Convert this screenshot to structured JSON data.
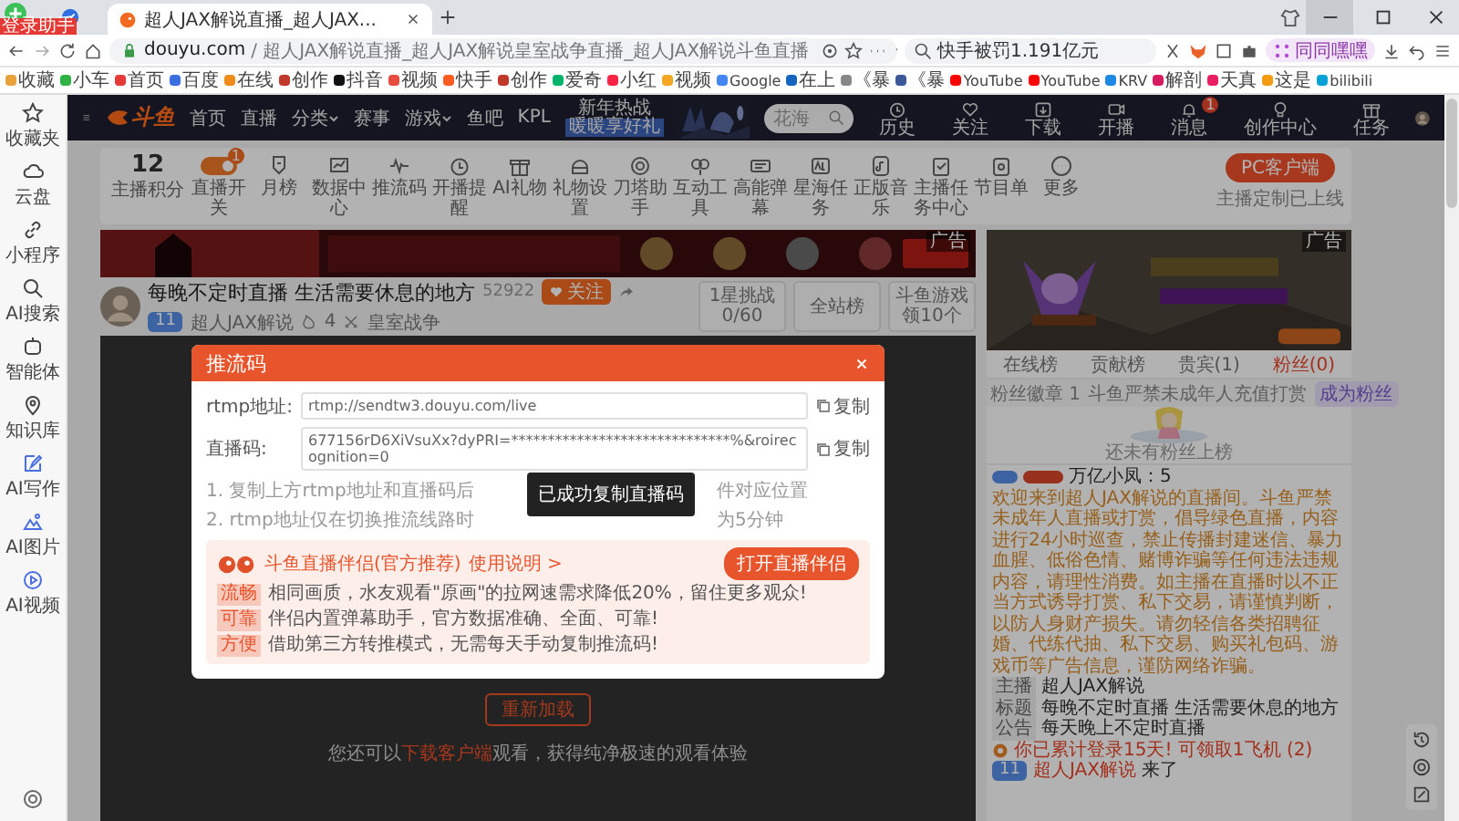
{
  "browser": {
    "tab_title": "超人JAX解说直播_超人JAX...",
    "login_badge": "登录助手",
    "url_domain": "douyu.com",
    "url_path": " / 超人JAX解说直播_超人JAX解说皇室战争直播_超人JAX解说斗鱼直播",
    "search_value": "快手被罚1.191亿元",
    "profile": "同同嘿嘿",
    "bookmarks": [
      "收藏",
      "小车",
      "首页",
      "百度",
      "在线",
      "创作",
      "抖音",
      "视频",
      "快手",
      "创作",
      "爱奇",
      "小红",
      "视频",
      "Google",
      "在上",
      "《暴",
      "《暴",
      "YouTube",
      "YouTube",
      "KRV",
      "解剖",
      "天真",
      "这是",
      "bilibili"
    ]
  },
  "sidebar": {
    "items": [
      "收藏夹",
      "云盘",
      "小程序",
      "AI搜索",
      "智能体",
      "知识库",
      "AI写作",
      "AI图片",
      "AI视频"
    ]
  },
  "header": {
    "logo": "斗鱼",
    "nav": [
      {
        "label": "首页",
        "dropdown": false
      },
      {
        "label": "直播",
        "dropdown": false
      },
      {
        "label": "分类",
        "dropdown": true
      },
      {
        "label": "赛事",
        "dropdown": false
      },
      {
        "label": "游戏",
        "dropdown": true
      },
      {
        "label": "鱼吧",
        "dropdown": false
      },
      {
        "label": "KPL",
        "dropdown": false
      }
    ],
    "promo": {
      "title": "新年热战",
      "sub": "暖暖享好礼"
    },
    "search": {
      "placeholder": "花海"
    },
    "actions": [
      {
        "label": "历史"
      },
      {
        "label": "关注"
      },
      {
        "label": "下载"
      },
      {
        "label": "开播"
      },
      {
        "label": "消息",
        "badge": "1"
      },
      {
        "label": "创作中心"
      },
      {
        "label": "任务"
      }
    ]
  },
  "toolbar": {
    "points": "12",
    "points_label": "主播积分",
    "items": [
      {
        "label": "直播开关",
        "kind": "switch",
        "on": true,
        "badge": "1"
      },
      {
        "label": "月榜",
        "kind": "icon"
      },
      {
        "label": "数据中心",
        "kind": "icon"
      },
      {
        "label": "推流码",
        "kind": "icon"
      },
      {
        "label": "开播提醒",
        "kind": "icon"
      },
      {
        "label": "AI礼物",
        "kind": "icon"
      },
      {
        "label": "礼物设置",
        "kind": "icon"
      },
      {
        "label": "刀塔助手",
        "kind": "icon"
      },
      {
        "label": "互动工具",
        "kind": "icon"
      },
      {
        "label": "高能弹幕",
        "kind": "icon"
      },
      {
        "label": "星海任务",
        "kind": "icon"
      },
      {
        "label": "正版音乐",
        "kind": "icon"
      },
      {
        "label": "主播任务中心",
        "kind": "icon"
      },
      {
        "label": "节目单",
        "kind": "icon"
      },
      {
        "label": "更多",
        "kind": "icon"
      }
    ],
    "client_button": "PC客户端",
    "client_note": "主播定制已上线"
  },
  "ad_banner": {
    "tag": "广告"
  },
  "room": {
    "title": "每晚不定时直播 生活需要休息的地方",
    "room_id": "52922",
    "follow": "关注",
    "level": "11",
    "streamer": "超人JAX解说",
    "likes": "4",
    "category": "皇室战争",
    "stats": [
      {
        "title": "1星挑战",
        "value": "0/60"
      },
      {
        "title": "全站榜"
      },
      {
        "title": "斗鱼游戏",
        "value": "领10个"
      }
    ]
  },
  "player": {
    "reload": "重新加载",
    "hint_before": "您还可以",
    "hint_link": "下载客户端",
    "hint_after": "观看，获得纯净极速的观看体验"
  },
  "modal": {
    "title": "推流码",
    "fields": [
      {
        "label": "rtmp地址:",
        "value": "rtmp://sendtw3.douyu.com/live",
        "copy": "复制"
      },
      {
        "label": "直播码:",
        "value": "677156rD6XiVsuXx?dyPRI=******************************%&roirecognition=0",
        "copy": "复制"
      }
    ],
    "notes": [
      {
        "before": "1. 复制上方rtmp地址和直播码后",
        "after": "件对应位置"
      },
      {
        "before": "2. rtmp地址仅在切换推流线路时",
        "after": "为5分钟"
      }
    ],
    "toast": "已成功复制直播码",
    "companion": {
      "title": "斗鱼直播伴侣(官方推荐)",
      "guide": "使用说明 >",
      "button": "打开直播伴侣",
      "features": [
        {
          "tag": "流畅",
          "text": "相同画质，水友观看\"原画\"的拉网速需求降低20%，留住更多观众!"
        },
        {
          "tag": "可靠",
          "text": "伴侣内置弹幕助手，官方数据准确、全面、可靠!"
        },
        {
          "tag": "方便",
          "text": "借助第三方转推模式，无需每天手动复制推流码!"
        }
      ]
    }
  },
  "right_panel": {
    "ad_tag": "广告",
    "tabs": [
      {
        "label": "在线榜",
        "selected": false
      },
      {
        "label": "贡献榜",
        "selected": false
      },
      {
        "label": "贵宾(1)",
        "selected": false
      },
      {
        "label": "粉丝(0)",
        "selected": true
      }
    ],
    "fans": {
      "badge_label": "粉丝徽章",
      "count": "1",
      "notice": "斗鱼严禁未成年人充值打赏",
      "button": "成为粉丝"
    },
    "empty": "还未有粉丝上榜",
    "chat": [
      {
        "kind": "user",
        "text": "万亿小凤：5"
      },
      {
        "kind": "system",
        "text": "欢迎来到超人JAX解说的直播间。斗鱼严禁未成年人直播或打赏，倡导绿色直播，内容进行24小时巡查，禁止传播封建迷信、暴力血腥、低俗色情、赌博诈骗等任何违法违规内容，请理性消费。如主播在直播时以不正当方式诱导打赏、私下交易，请谨慎判断，以防人身财产损失。请勿轻信各类招聘征婚、代练代抽、私下交易、购买礼包码、游戏币等广告信息，谨防网络诈骗。"
      },
      {
        "kind": "info",
        "tag": "主播",
        "text": "超人JAX解说"
      },
      {
        "kind": "info",
        "tag": "标题",
        "text": "每晚不定时直播 生活需要休息的地方"
      },
      {
        "kind": "info",
        "tag": "公告",
        "text": "每天晚上不定时直播"
      },
      {
        "kind": "login",
        "text": "你已累计登录15天! 可领取1飞机 (2)"
      },
      {
        "kind": "enter",
        "level": "11",
        "name": "超人JAX解说",
        "text": " 来了"
      }
    ]
  }
}
